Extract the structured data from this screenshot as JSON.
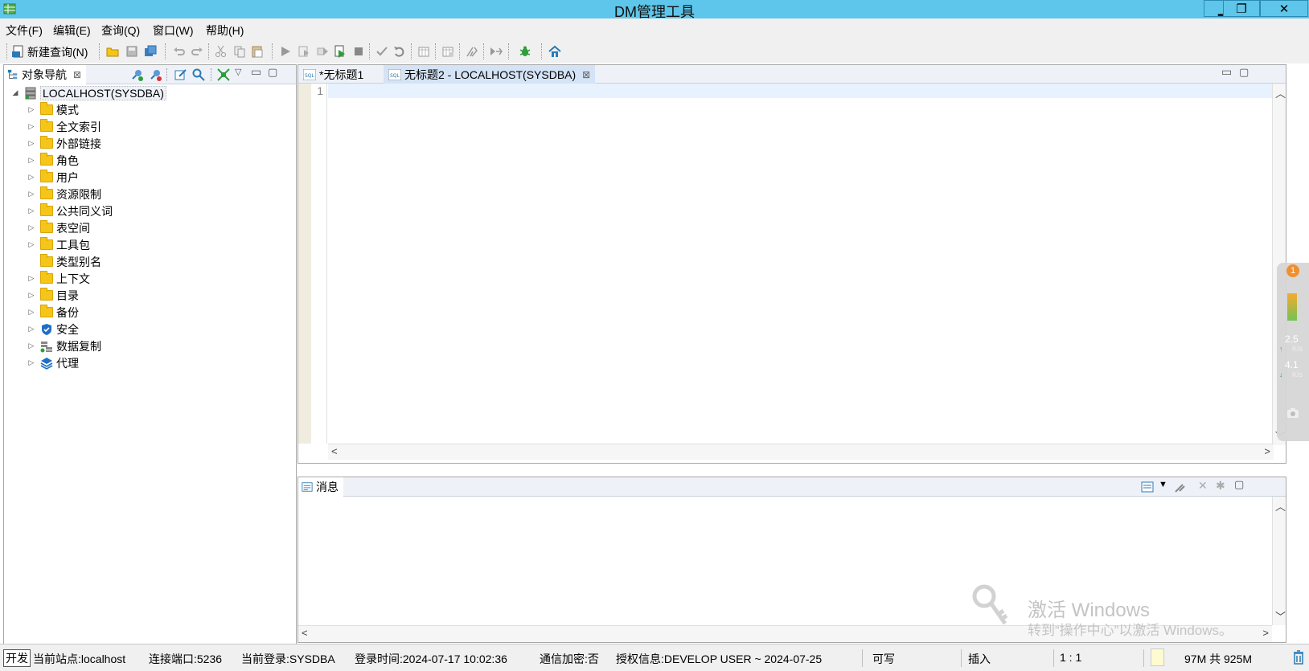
{
  "window": {
    "title": "DM管理工具",
    "min": "▁",
    "max": "❐",
    "close": "✕"
  },
  "menu": [
    "文件(F)",
    "编辑(E)",
    "查询(Q)",
    "窗口(W)",
    "帮助(H)"
  ],
  "toolbar": {
    "new_query": "新建查询(N)"
  },
  "navigator": {
    "tab_label": "对象导航",
    "root": "LOCALHOST(SYSDBA)",
    "items": [
      "模式",
      "全文索引",
      "外部链接",
      "角色",
      "用户",
      "资源限制",
      "公共同义词",
      "表空间",
      "工具包",
      "类型别名",
      "上下文",
      "目录",
      "备份",
      "安全",
      "数据复制",
      "代理"
    ]
  },
  "editor": {
    "tabs": [
      "*无标题1",
      "无标题2 - LOCALHOST(SYSDBA)"
    ],
    "line_number": "1"
  },
  "messages": {
    "tab_label": "消息"
  },
  "floating_widget": {
    "badge": "1",
    "up_speed": "2.5",
    "down_speed": "4.1",
    "unit": "K/s"
  },
  "watermark": {
    "line1": "激活 Windows",
    "line2": "转到“操作中心”以激活 Windows。"
  },
  "status": {
    "mode_badge": "开发",
    "site": "当前站点:localhost",
    "port": "连接端口:5236",
    "login_user": "当前登录:SYSDBA",
    "login_time": "登录时间:2024-07-17 10:02:36",
    "encryption": "通信加密:否",
    "license": "授权信息:DEVELOP USER ~ 2024-07-25",
    "writable": "可写",
    "insert_mode": "插入",
    "cursor_pos": "1 : 1",
    "memory": "97M 共 925M"
  },
  "colors": {
    "titlebar": "#5ec6ea",
    "folder": "#f5c518",
    "current_line": "#e8f2fe"
  }
}
